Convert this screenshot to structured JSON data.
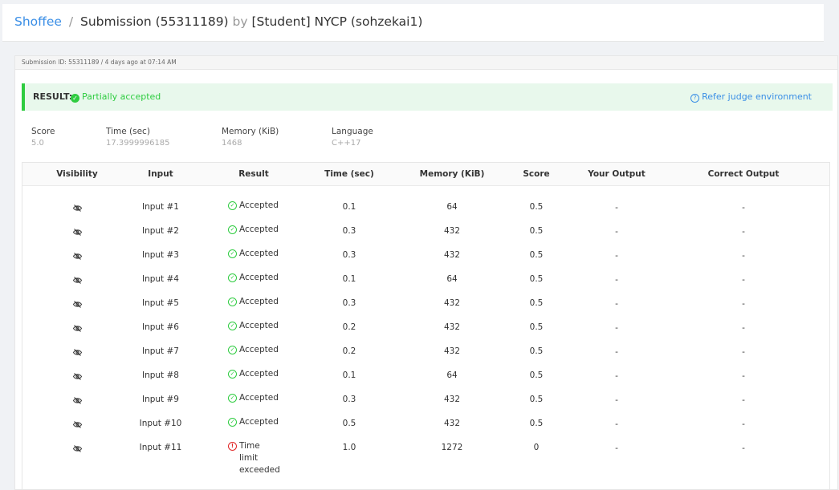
{
  "breadcrumb": {
    "root": "Shoffee",
    "separator": "/",
    "submission": "Submission (55311189)",
    "by": "by",
    "author": "[Student] NYCP (sohzekai1)"
  },
  "submission_meta": "Submission ID: 55311189 / 4 days ago at 07:14 AM",
  "result": {
    "label": "RESULT:",
    "value": "Partially accepted",
    "refer": "Refer judge environment"
  },
  "stats": {
    "score_label": "Score",
    "score": "5.0",
    "time_label": "Time (sec)",
    "time": "17.3999996185",
    "memory_label": "Memory (KiB)",
    "memory": "1468",
    "language_label": "Language",
    "language": "C++17"
  },
  "table": {
    "headers": [
      "Visibility",
      "Input",
      "Result",
      "Time (sec)",
      "Memory (KiB)",
      "Score",
      "Your Output",
      "Correct Output"
    ],
    "rows": [
      {
        "input": "Input #1",
        "result": "Accepted",
        "time": "0.1",
        "memory": "64",
        "score": "0.5",
        "your": "-",
        "correct": "-"
      },
      {
        "input": "Input #2",
        "result": "Accepted",
        "time": "0.3",
        "memory": "432",
        "score": "0.5",
        "your": "-",
        "correct": "-"
      },
      {
        "input": "Input #3",
        "result": "Accepted",
        "time": "0.3",
        "memory": "432",
        "score": "0.5",
        "your": "-",
        "correct": "-"
      },
      {
        "input": "Input #4",
        "result": "Accepted",
        "time": "0.1",
        "memory": "64",
        "score": "0.5",
        "your": "-",
        "correct": "-"
      },
      {
        "input": "Input #5",
        "result": "Accepted",
        "time": "0.3",
        "memory": "432",
        "score": "0.5",
        "your": "-",
        "correct": "-"
      },
      {
        "input": "Input #6",
        "result": "Accepted",
        "time": "0.2",
        "memory": "432",
        "score": "0.5",
        "your": "-",
        "correct": "-"
      },
      {
        "input": "Input #7",
        "result": "Accepted",
        "time": "0.2",
        "memory": "432",
        "score": "0.5",
        "your": "-",
        "correct": "-"
      },
      {
        "input": "Input #8",
        "result": "Accepted",
        "time": "0.1",
        "memory": "64",
        "score": "0.5",
        "your": "-",
        "correct": "-"
      },
      {
        "input": "Input #9",
        "result": "Accepted",
        "time": "0.3",
        "memory": "432",
        "score": "0.5",
        "your": "-",
        "correct": "-"
      },
      {
        "input": "Input #10",
        "result": "Accepted",
        "time": "0.5",
        "memory": "432",
        "score": "0.5",
        "your": "-",
        "correct": "-"
      },
      {
        "input": "Input #11",
        "result_lines": [
          "Time",
          "limit",
          "exceeded"
        ],
        "time": "1.0",
        "memory": "1272",
        "score": "0",
        "your": "-",
        "correct": "-"
      }
    ]
  },
  "colors": {
    "accent": "#3a8ee6",
    "success": "#2ecc40",
    "error": "#e02424"
  },
  "icons": {
    "visibility": "eye-slash-icon",
    "accepted": "check-circle-icon",
    "tle": "exclamation-circle-icon",
    "help": "question-circle-icon"
  }
}
